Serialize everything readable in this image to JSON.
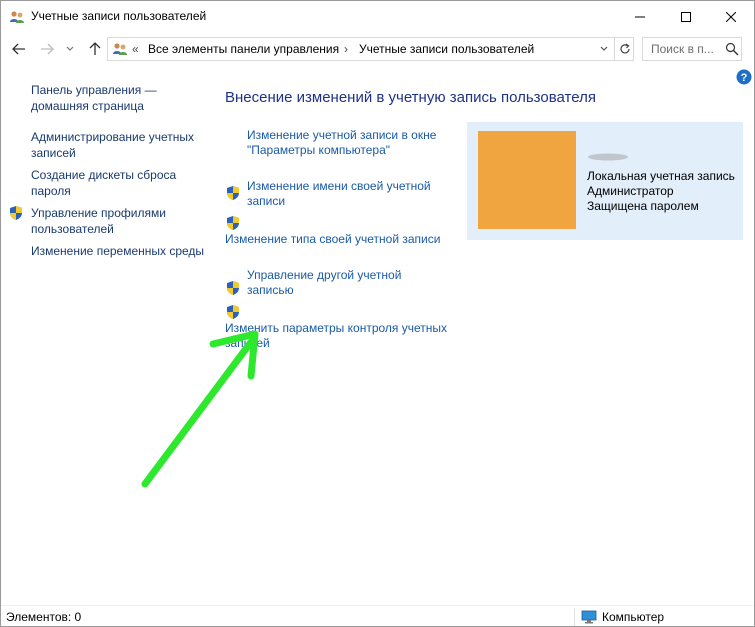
{
  "window": {
    "title": "Учетные записи пользователей",
    "icon": "users-icon",
    "controls": [
      "minimize-icon",
      "maximize-icon",
      "close-icon"
    ]
  },
  "navigation": {
    "back_icon": "arrow-left-icon",
    "forward_icon": "arrow-right-icon",
    "recent_icon": "chevron-down-icon",
    "up_icon": "arrow-up-icon",
    "address": {
      "overflow": "«",
      "crumbs": [
        "Все элементы панели управления",
        "Учетные записи пользователей"
      ],
      "separator": "›"
    },
    "search_placeholder": "Поиск в п..."
  },
  "left_pane": {
    "items": [
      {
        "label": "Панель управления — домашняя страница"
      },
      {
        "label": "Администрирование учетных записей"
      },
      {
        "label": "Создание дискеты сброса пароля"
      },
      {
        "label": "Управление профилями пользователей",
        "icon": "uac-shield-icon"
      },
      {
        "label": "Изменение переменных среды"
      }
    ]
  },
  "main": {
    "heading": "Внесение изменений в учетную запись пользователя",
    "tasks": [
      {
        "label": "Изменение учетной записи в окне \"Параметры компьютера\""
      },
      {
        "label": "Изменение имени своей учетной записи",
        "icon": "uac-shield-icon"
      },
      {
        "label": "Изменение типа своей учетной записи",
        "icon": "uac-shield-icon"
      },
      {
        "label": "Управление другой учетной записью",
        "icon": "uac-shield-icon"
      },
      {
        "label": "Изменить параметры контроля учетных записей",
        "icon": "uac-shield-icon"
      }
    ]
  },
  "user_card": {
    "avatar_color": "#f0a540",
    "lines": [
      "Локальная учетная запись",
      "Администратор",
      "Защищена паролем"
    ]
  },
  "status_bar": {
    "items_count": "Элементов: 0",
    "zone": "Компьютер"
  },
  "colors": {
    "link": "#1a5aa6",
    "heading": "#1e3287",
    "card_bg": "#e2eef9",
    "arrow": "#2ee82e"
  }
}
